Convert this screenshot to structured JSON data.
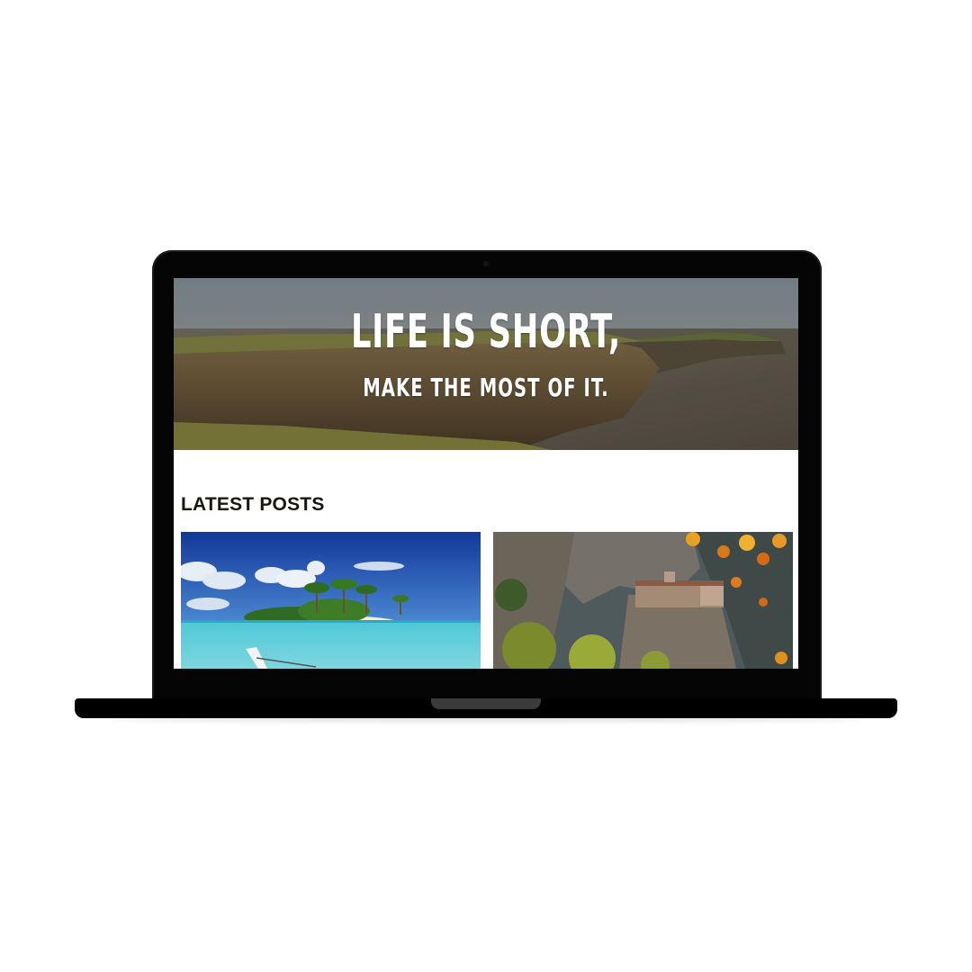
{
  "hero": {
    "title": "LIFE IS SHORT,",
    "subtitle": "MAKE THE MOST OF IT."
  },
  "latest_posts": {
    "heading": "LATEST POSTS",
    "posts": [
      {
        "image": "tropical-island-photo"
      },
      {
        "image": "cliff-monastery-photo"
      }
    ]
  },
  "colors": {
    "device_body": "#050505",
    "heading_text": "#1c1610",
    "hero_text": "#ffffff"
  }
}
